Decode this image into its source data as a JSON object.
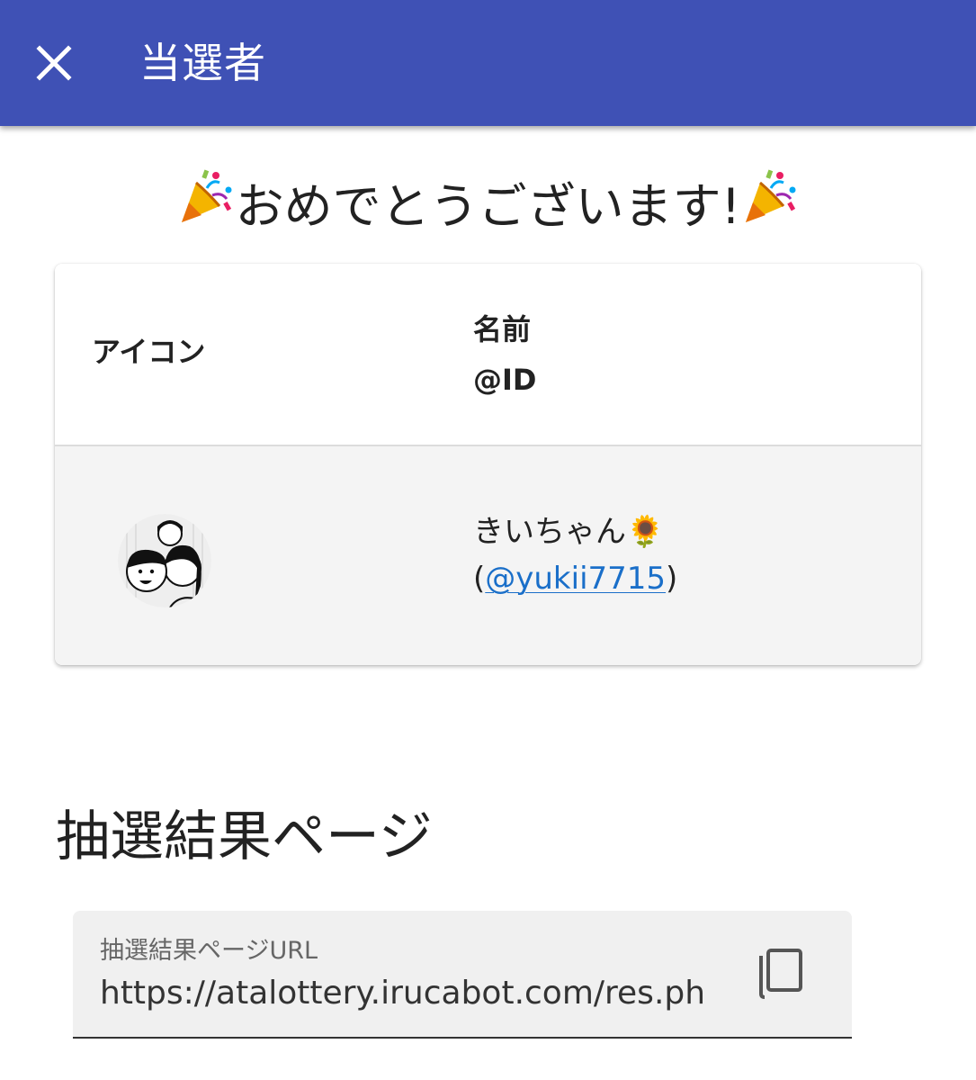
{
  "appbar": {
    "title": "当選者",
    "close_icon": "close-icon",
    "background": "#3f51b5"
  },
  "congrats": {
    "text": "おめでとうございます!",
    "left_icon": "party-popper-icon",
    "right_icon": "party-popper-icon"
  },
  "winners_table": {
    "headers": {
      "icon": "アイコン",
      "name": "名前",
      "id": "@ID"
    },
    "rows": [
      {
        "avatar": "avatar",
        "name": "きいちゃん🌻",
        "id_prefix": "(",
        "id_link": "@yukii7715",
        "id_suffix": ")"
      }
    ]
  },
  "results": {
    "title": "抽選結果ページ",
    "url_label": "抽選結果ページURL",
    "url_value": "https://atalottery.irucabot.com/res.ph",
    "copy_icon": "copy-icon"
  },
  "colors": {
    "link": "#1a6fc9",
    "row_bg": "#f4f4f4"
  }
}
